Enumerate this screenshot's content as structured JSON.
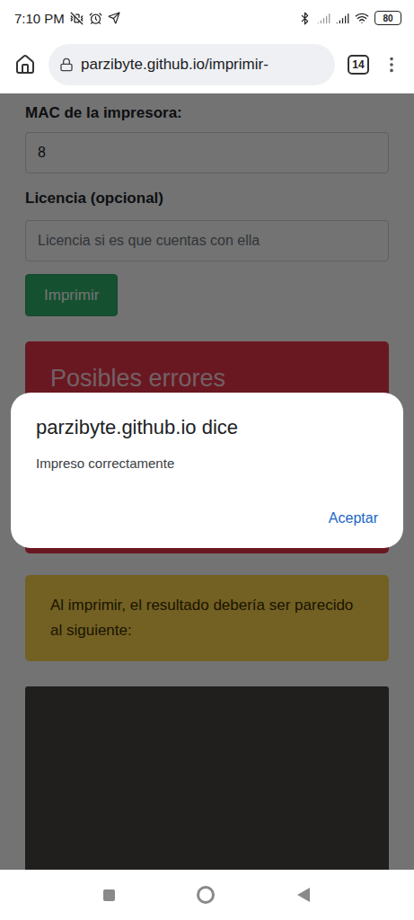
{
  "status_bar": {
    "time": "7:10 PM",
    "battery": "80"
  },
  "browser": {
    "url": "parzibyte.github.io/imprimir-",
    "tab_count": "14"
  },
  "form": {
    "fields": [
      {
        "label": "MAC de la impresora:",
        "value": "8",
        "placeholder": "",
        "redacted": true
      },
      {
        "label": "Licencia (opcional)",
        "value": "",
        "placeholder": "Licencia si es que cuentas con ella",
        "redacted": false
      }
    ],
    "button": "Imprimir"
  },
  "errors_box": {
    "title": "Posibles errores"
  },
  "dialog": {
    "title": "parzibyte.github.io dice",
    "message": "Impreso correctamente",
    "button": "Aceptar"
  },
  "info_box": {
    "text": "Al imprimir, el resultado debería ser parecido al siguiente:"
  }
}
